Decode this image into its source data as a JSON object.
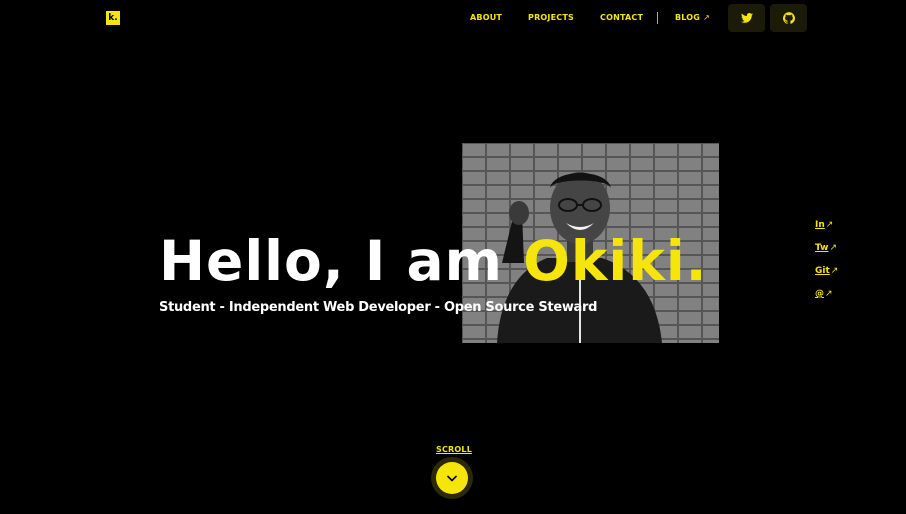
{
  "brand": {
    "logo_text": "k."
  },
  "nav": {
    "items": [
      "ABOUT",
      "PROJECTS",
      "CONTACT",
      "BLOG"
    ],
    "blog_arrow": "↗"
  },
  "hero": {
    "greeting": "Hello, I am",
    "name": "Okiki.",
    "subtitle": "Student - Independent Web Developer - Open Source Steward"
  },
  "social": [
    {
      "label": "In",
      "arrow": "↗"
    },
    {
      "label": "Tw",
      "arrow": "↗"
    },
    {
      "label": "Git",
      "arrow": "↗"
    },
    {
      "label": "@",
      "arrow": "↗"
    }
  ],
  "scroll": {
    "label": "SCROLL"
  },
  "icons": {
    "twitter": "twitter-icon",
    "github": "github-icon",
    "scroll": "chevron-down-icon"
  },
  "colors": {
    "accent": "#f5e50a",
    "background": "#000000",
    "text": "#ffffff"
  }
}
